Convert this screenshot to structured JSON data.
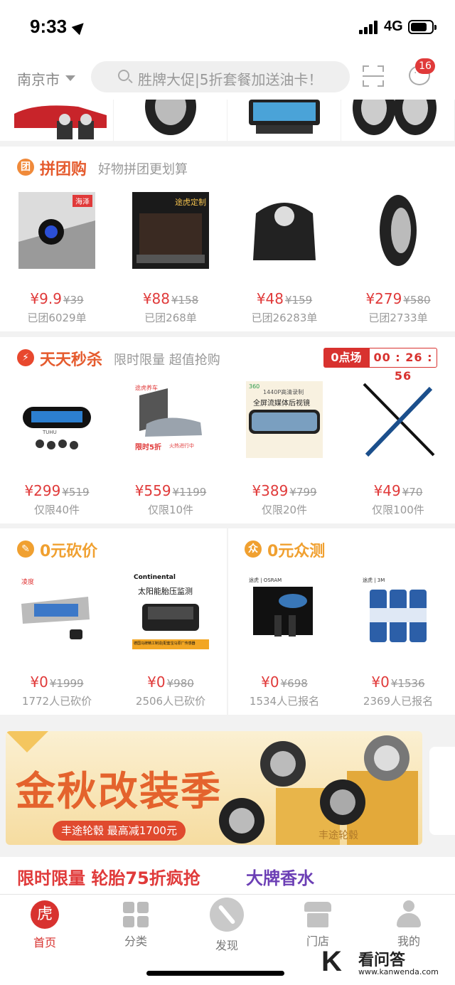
{
  "status_bar": {
    "time": "9:33",
    "network": "4G"
  },
  "header": {
    "city": "南京市",
    "search_placeholder": "胜牌大促|5折套餐加送油卡！",
    "message_count": "16"
  },
  "group_buy": {
    "title": "拼团购",
    "subtitle": "好物拼团更划算",
    "icon_glyph": "团",
    "tag": "海泽",
    "items": [
      {
        "price": "¥9.9",
        "old": "¥39",
        "meta": "已团6029单",
        "badge": ""
      },
      {
        "price": "¥88",
        "old": "¥158",
        "meta": "已团268单",
        "badge": "途虎定制"
      },
      {
        "price": "¥48",
        "old": "¥159",
        "meta": "已团26283单",
        "badge": ""
      },
      {
        "price": "¥279",
        "old": "¥580",
        "meta": "已团2733单",
        "badge": ""
      }
    ]
  },
  "flash_sale": {
    "title": "天天秒杀",
    "subtitle": "限时限量 超值抢购",
    "session": "0点场",
    "countdown": "00 : 26 : 56",
    "items": [
      {
        "price": "¥299",
        "old": "¥519",
        "meta": "仅限40件"
      },
      {
        "price": "¥559",
        "old": "¥1199",
        "meta": "仅限10件"
      },
      {
        "price": "¥389",
        "old": "¥799",
        "meta": "仅限20件"
      },
      {
        "price": "¥49",
        "old": "¥70",
        "meta": "仅限100件"
      }
    ],
    "img_texts": {
      "tpms_brand": "TUHU",
      "film_brand": "途虎养车",
      "film_promo": "限时5折",
      "film_promo2": "火热进行中",
      "dvr_brand": "360",
      "dvr_line1": "1440P高清录制",
      "dvr_line2": "全屏流媒体后视镜"
    }
  },
  "bargain": {
    "title": "0元砍价",
    "items": [
      {
        "price": "¥0",
        "old": "¥1999",
        "meta": "1772人已砍价"
      },
      {
        "price": "¥0",
        "old": "¥980",
        "meta": "2506人已砍价"
      }
    ],
    "img_texts": {
      "brand1": "凌度",
      "brand2": "Continental",
      "caption2": "太阳能胎压监测",
      "foot2": "德国马牌精工制造|配套宝马原厂传感器"
    }
  },
  "free_test": {
    "title": "0元众测",
    "icon_glyph": "众",
    "items": [
      {
        "price": "¥0",
        "old": "¥698",
        "meta": "1534人已报名"
      },
      {
        "price": "¥0",
        "old": "¥1536",
        "meta": "2369人已报名"
      }
    ],
    "img_texts": {
      "brand1": "途虎 | OSRAM",
      "brand2": "途虎 | 3M"
    }
  },
  "banner": {
    "title": "金秋改装季",
    "subtitle": "丰途轮毂 最高减1700元",
    "brand": "丰途轮毂"
  },
  "promos": {
    "left": "限时限量 轮胎75折疯抢",
    "right": "大牌香水"
  },
  "tabbar": {
    "home_glyph": "虎",
    "items": [
      {
        "label": "首页"
      },
      {
        "label": "分类"
      },
      {
        "label": "发现"
      },
      {
        "label": "门店"
      },
      {
        "label": "我的"
      }
    ]
  },
  "watermark": {
    "letter": "K",
    "name": "看问答",
    "url": "www.kanwenda.com"
  },
  "colors": {
    "accent": "#d8322f",
    "bargain": "#f0a030",
    "purple": "#6c3fb5"
  }
}
